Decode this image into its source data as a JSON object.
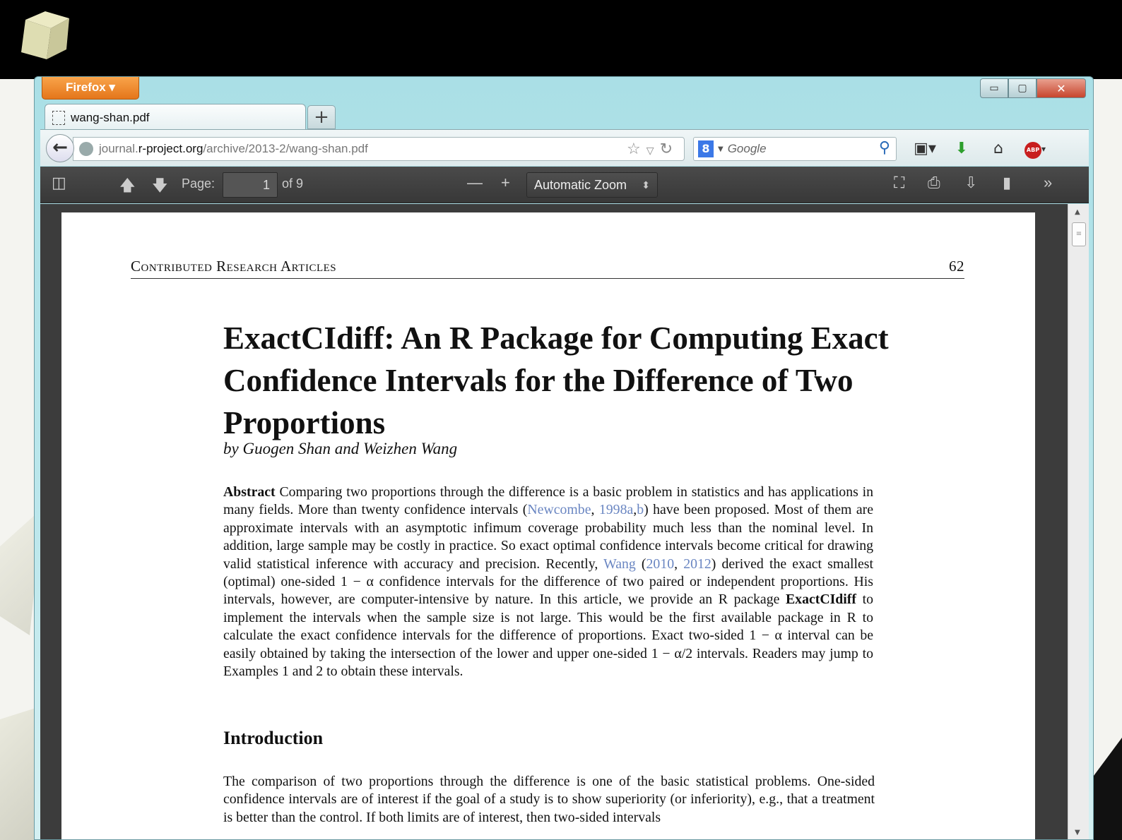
{
  "browser": {
    "app_button": "Firefox ▾",
    "tab_title": "wang-shan.pdf",
    "new_tab": "+",
    "url_prefix": "journal.",
    "url_domain": "r-project.org",
    "url_path": "/archive/2013-2/wang-shan.pdf",
    "search_placeholder": "Google",
    "window_controls": {
      "minimize": "▭",
      "maximize": "▢",
      "close": "✕"
    }
  },
  "pdf_toolbar": {
    "page_label": "Page:",
    "page_value": "1",
    "page_total": "of 9",
    "zoom": "Automatic Zoom",
    "zoom_caret": "⬍",
    "zoom_out": "—",
    "zoom_in": "+"
  },
  "document": {
    "running_head": "Contributed Research Articles",
    "page_number": "62",
    "title": "ExactCIdiff: An R Package for Computing Exact Confidence Intervals for the Difference of Two Proportions",
    "byline": "by Guogen Shan and Weizhen Wang",
    "abstract_label": "Abstract",
    "abstract_parts": {
      "p1": " Comparing two proportions through the difference is a basic problem in statistics and has applications in many fields. More than twenty confidence intervals (",
      "c1": "Newcombe",
      "s1": ", ",
      "c2": "1998a",
      "s2": ",",
      "c3": "b",
      "p2": ") have been proposed. Most of them are approximate intervals with an asymptotic infimum coverage probability much less than the nominal level.  In addition, large sample may be costly in practice.  So exact optimal confidence intervals become critical for drawing valid statistical inference with accuracy and precision. Recently, ",
      "c4": "Wang",
      "s3": " (",
      "c5": "2010",
      "s4": ", ",
      "c6": "2012",
      "p3": ") derived the exact smallest (optimal) one-sided 1 − α confidence intervals for the difference of two paired or independent proportions.  His intervals, however, are computer-intensive by nature. In this article, we provide an R package ",
      "pkg": "ExactCIdiff",
      "p4": " to implement the intervals when the sample size is not large. This would be the first available package in R to calculate the exact confidence intervals for the difference of proportions. Exact two-sided 1 − α interval can be easily obtained by taking the intersection of the lower and upper one-sided 1 − α/2 intervals. Readers may jump to Examples 1 and 2 to obtain these intervals."
    },
    "section_heading": "Introduction",
    "intro_text": "The comparison of two proportions through the difference is one of the basic statistical problems. One-sided confidence intervals are of interest if the goal of a study is to show superiority (or inferiority), e.g., that a treatment is better than the control. If both limits are of interest, then two-sided intervals"
  },
  "icons": [
    "back-arrow-icon",
    "globe-icon",
    "bookmark-star-icon",
    "reload-icon",
    "search-icon",
    "bookmarks-icon",
    "download-icon",
    "home-icon",
    "adblock-icon",
    "sidebar-toggle-icon",
    "page-up-icon",
    "page-down-icon",
    "fullscreen-icon",
    "print-icon",
    "save-icon",
    "bookmark-icon",
    "tools-icon"
  ],
  "colors": {
    "firefox_button": "#e4761b",
    "link": "#6a86c2",
    "toolbar_dark": "#3c3c3c"
  }
}
